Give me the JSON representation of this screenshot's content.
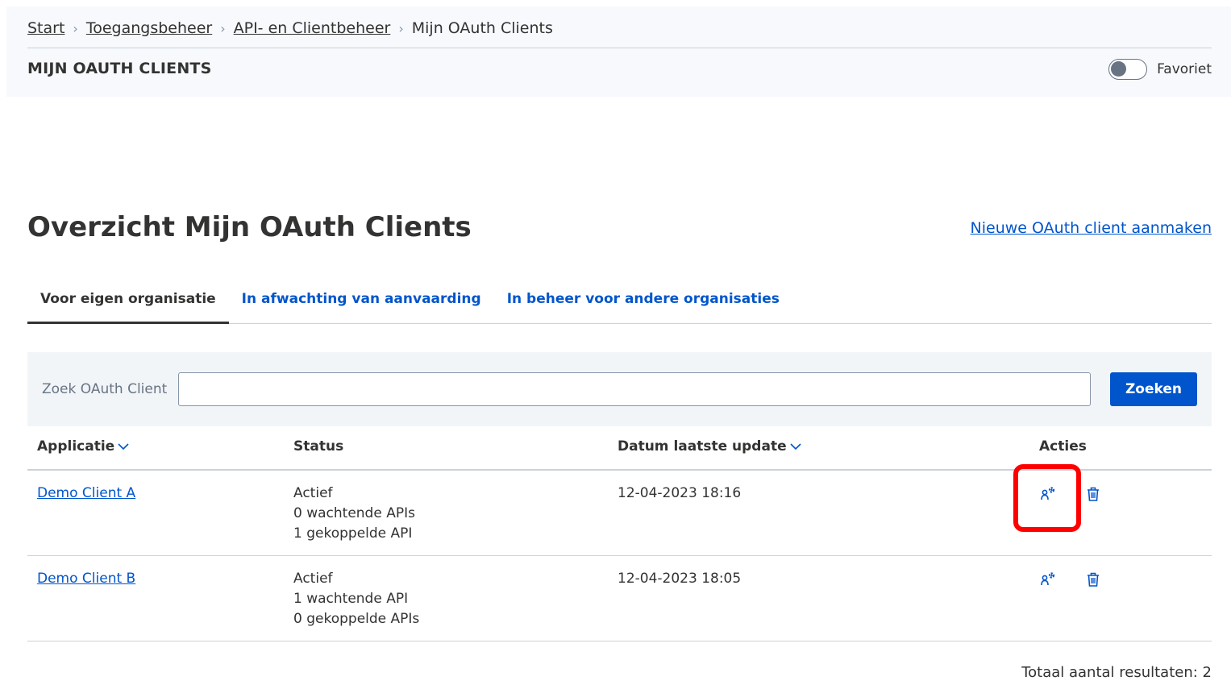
{
  "breadcrumb": {
    "items": [
      "Start",
      "Toegangsbeheer",
      "API- en Clientbeheer"
    ],
    "current": "Mijn OAuth Clients"
  },
  "header": {
    "page_label": "MIJN OAUTH CLIENTS",
    "favorite_label": "Favoriet",
    "favorite_on": false
  },
  "main": {
    "title": "Overzicht Mijn OAuth Clients",
    "new_link": "Nieuwe OAuth client aanmaken"
  },
  "tabs": [
    {
      "label": "Voor eigen organisatie",
      "active": true
    },
    {
      "label": "In afwachting van aanvaarding",
      "active": false
    },
    {
      "label": "In beheer voor andere organisaties",
      "active": false
    }
  ],
  "search": {
    "label": "Zoek OAuth Client",
    "value": "",
    "button": "Zoeken"
  },
  "table": {
    "headers": {
      "app": "Applicatie",
      "status": "Status",
      "date": "Datum laatste update",
      "actions": "Acties"
    },
    "rows": [
      {
        "name": "Demo Client A",
        "status": "Actief",
        "pending": "0 wachtende APIs",
        "linked": "1 gekoppelde API",
        "date": "12-04-2023 18:16"
      },
      {
        "name": "Demo Client B",
        "status": "Actief",
        "pending": "1 wachtende API",
        "linked": "0 gekoppelde APIs",
        "date": "12-04-2023 18:05"
      }
    ]
  },
  "footer": {
    "total": "Totaal aantal resultaten: 2"
  },
  "colors": {
    "accent": "#0055cc",
    "highlight": "#ff0000"
  },
  "icons": [
    "chevron-right-icon",
    "chevron-down-icon",
    "user-settings-icon",
    "trash-icon"
  ]
}
